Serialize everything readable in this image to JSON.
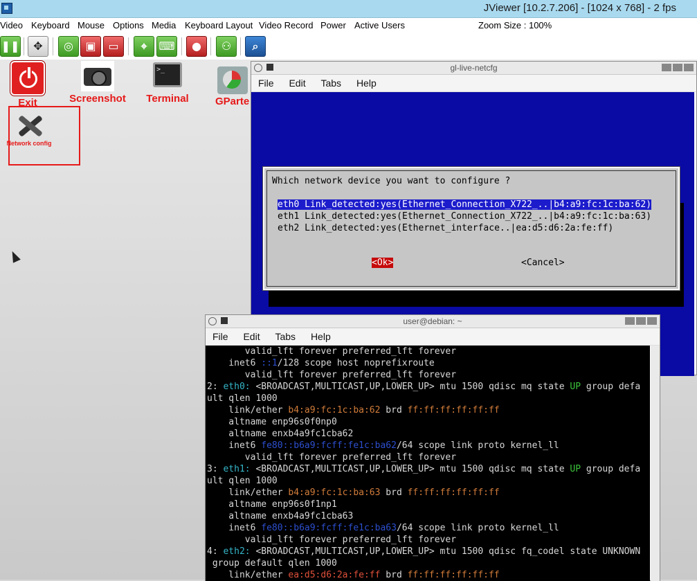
{
  "titlebar": {
    "title": "JViewer [10.2.7.206] - [1024 x 768] - 2 fps"
  },
  "menubar": {
    "items": [
      "Video",
      "Keyboard",
      "Mouse",
      "Options",
      "Media",
      "Keyboard Layout",
      "Video Record",
      "Power",
      "Active Users"
    ],
    "zoom": "Zoom Size : 100%"
  },
  "toolbar": {
    "buttons": [
      "pause-icon",
      "fullscreen-icon",
      "cd-icon",
      "floppy-icon",
      "usb-icon",
      "mouse-icon",
      "keyboard-icon",
      "record-icon",
      "power-icon",
      "zoom-icon"
    ]
  },
  "desktop": {
    "icons": [
      {
        "label": "Exit",
        "icon": "power-icon"
      },
      {
        "label": "Screenshot",
        "icon": "camera-icon"
      },
      {
        "label": "Terminal",
        "icon": "terminal-icon"
      },
      {
        "label": "GParte",
        "icon": "gparted-icon"
      },
      {
        "label": "Network config",
        "icon": "tools-icon"
      }
    ],
    "terminal_icon_text": ">_"
  },
  "netcfg_window": {
    "title": "gl-live-netcfg",
    "menu": [
      "File",
      "Edit",
      "Tabs",
      "Help"
    ],
    "question": "Which network device you want to configure ?",
    "options": [
      "eth0 Link_detected:yes(Ethernet_Connection_X722_..|b4:a9:fc:1c:ba:62)",
      "eth1 Link_detected:yes(Ethernet_Connection_X722_..|b4:a9:fc:1c:ba:63)",
      "eth2 Link_detected:yes(Ethernet_interface..|ea:d5:d6:2a:fe:ff)"
    ],
    "ok": "<Ok>",
    "cancel": "<Cancel>"
  },
  "terminal_window": {
    "title": "user@debian: ~",
    "menu": [
      "File",
      "Edit",
      "Tabs",
      "Help"
    ],
    "lines": {
      "l1": "       valid_lft forever preferred_lft forever",
      "l2a": "    inet6 ",
      "l2b": "::1",
      "l2c": "/128 scope host noprefixroute",
      "l3": "       valid_lft forever preferred_lft forever",
      "l4a": "2: ",
      "l4b": "eth0:",
      "l4c": " <BROADCAST,MULTICAST,UP,LOWER_UP> mtu 1500 qdisc mq state ",
      "l4d": "UP",
      "l4e": " group defa",
      "l5": "ult qlen 1000",
      "l6a": "    link/ether ",
      "l6b": "b4:a9:fc:1c:ba:62",
      "l6c": " brd ",
      "l6d": "ff:ff:ff:ff:ff:ff",
      "l7": "    altname enp96s0f0np0",
      "l8": "    altname enxb4a9fc1cba62",
      "l9a": "    inet6 ",
      "l9b": "fe80::b6a9:fcff:fe1c:ba62",
      "l9c": "/64 scope link proto kernel_ll",
      "l10": "       valid_lft forever preferred_lft forever",
      "l11a": "3: ",
      "l11b": "eth1:",
      "l11c": " <BROADCAST,MULTICAST,UP,LOWER_UP> mtu 1500 qdisc mq state ",
      "l11d": "UP",
      "l11e": " group defa",
      "l12": "ult qlen 1000",
      "l13a": "    link/ether ",
      "l13b": "b4:a9:fc:1c:ba:63",
      "l13c": " brd ",
      "l13d": "ff:ff:ff:ff:ff:ff",
      "l14": "    altname enp96s0f1np1",
      "l15": "    altname enxb4a9fc1cba63",
      "l16a": "    inet6 ",
      "l16b": "fe80::b6a9:fcff:fe1c:ba63",
      "l16c": "/64 scope link proto kernel_ll",
      "l17": "       valid_lft forever preferred_lft forever",
      "l18a": "4: ",
      "l18b": "eth2:",
      "l18c": " <BROADCAST,MULTICAST,UP,LOWER_UP> mtu 1500 qdisc fq_codel state UNKNOWN",
      "l19": " group default qlen 1000",
      "l20a": "    link/ether ",
      "l20b": "ea:d5:d6:2a:fe:ff",
      "l20c": " brd ",
      "l20d": "ff:ff:ff:ff:ff:ff"
    }
  },
  "colors": {
    "titlebar_bg": "#a9d9ef",
    "dialog_bg": "#0a0aa5",
    "label_red": "#e61919",
    "ok_red": "#c60a0a"
  }
}
